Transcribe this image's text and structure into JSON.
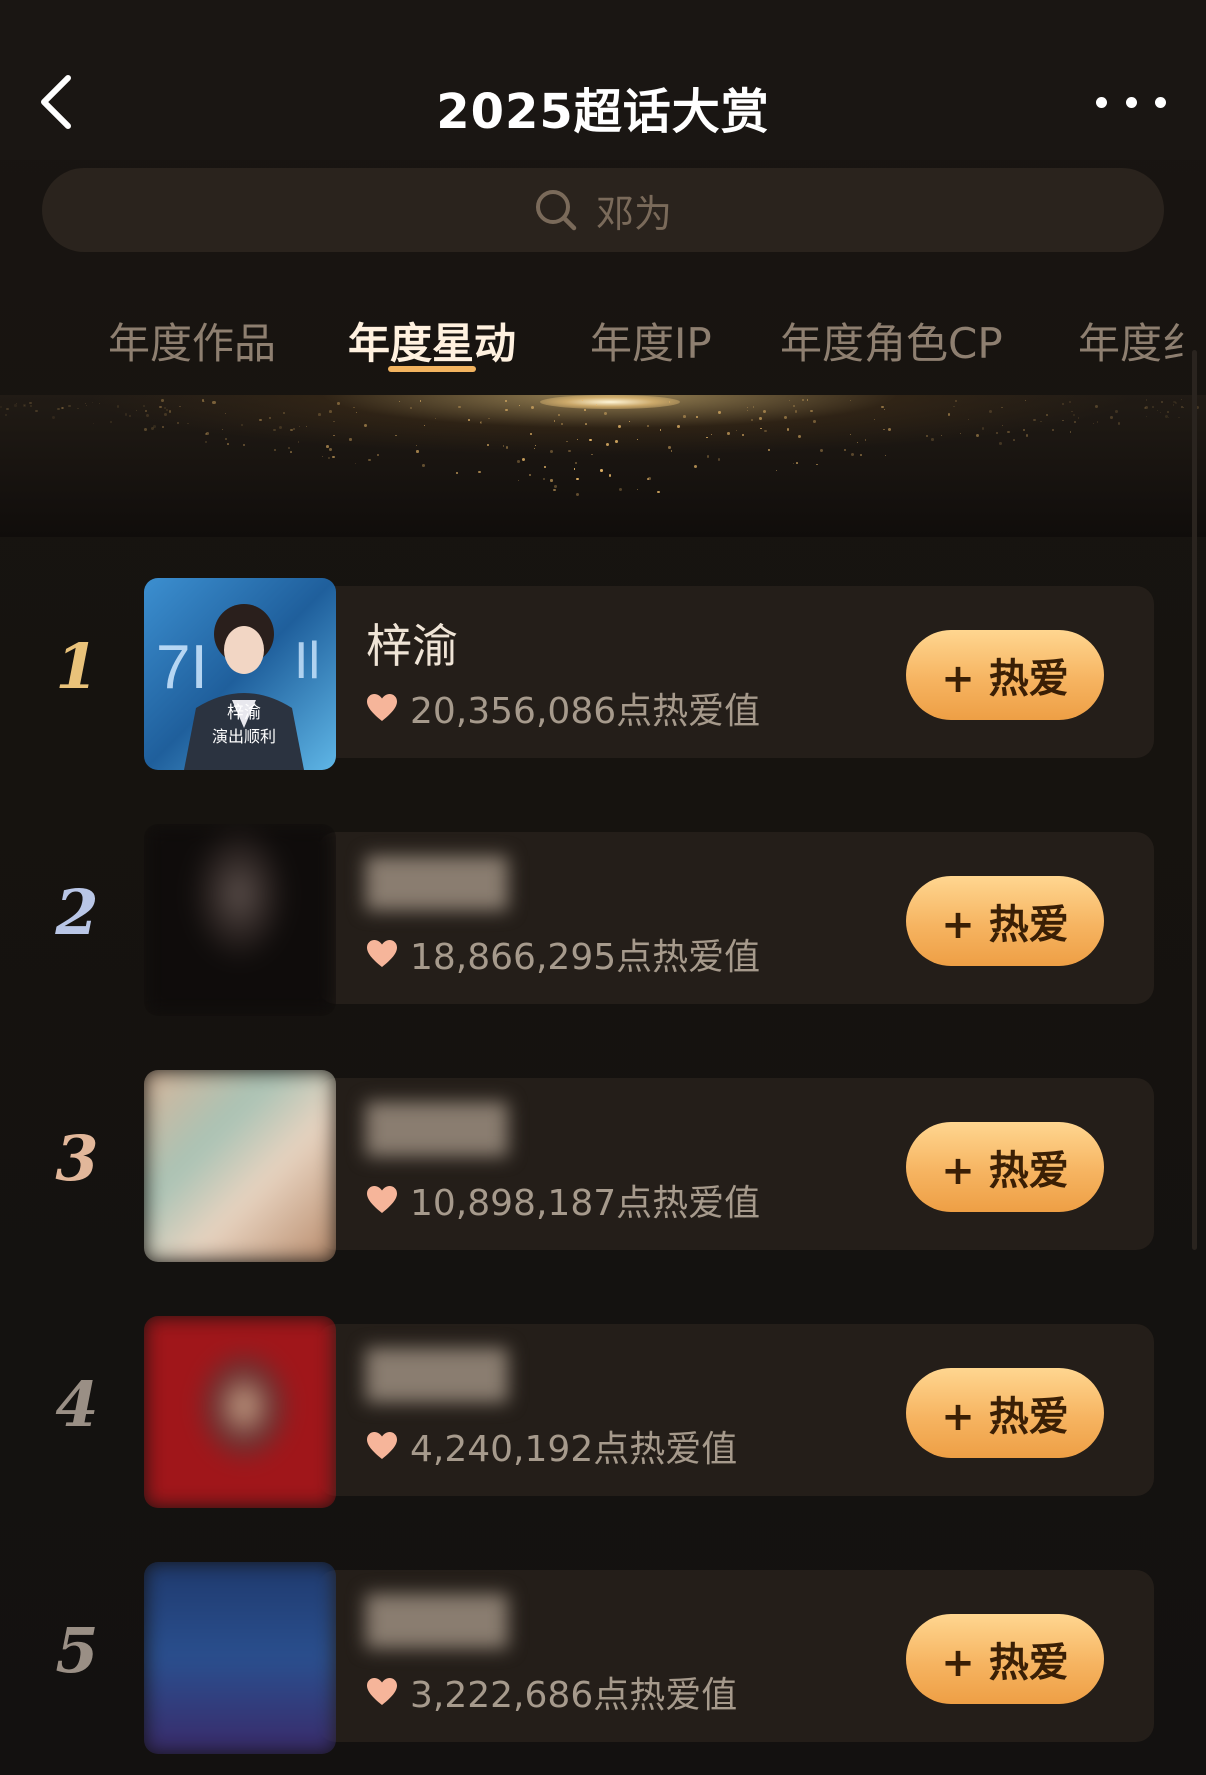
{
  "header": {
    "title": "2025超话大赏"
  },
  "search": {
    "placeholder": "邓为"
  },
  "tabs": [
    {
      "label": "年度作品",
      "active": false
    },
    {
      "label": "年度星动",
      "active": true
    },
    {
      "label": "年度IP",
      "active": false
    },
    {
      "label": "年度角色CP",
      "active": false
    },
    {
      "label": "年度纟",
      "active": false
    }
  ],
  "ranking": [
    {
      "rank": "1",
      "name": "梓渝",
      "heat": "20,356,086点热爱值",
      "button": "+ 热爱",
      "avatar_text": "梓渝",
      "avatar_subtext": "演出顺利",
      "blurred": false
    },
    {
      "rank": "2",
      "name": "",
      "heat": "18,866,295点热爱值",
      "button": "+ 热爱",
      "blurred": true
    },
    {
      "rank": "3",
      "name": "",
      "heat": "10,898,187点热爱值",
      "button": "+ 热爱",
      "blurred": true
    },
    {
      "rank": "4",
      "name": "",
      "heat": "4,240,192点热爱值",
      "button": "+ 热爱",
      "blurred": true
    },
    {
      "rank": "5",
      "name": "",
      "heat": "3,222,686点热爱值",
      "button": "+ 热爱",
      "blurred": true
    }
  ],
  "colors": {
    "accent": "#f6b461",
    "rank1": "#e9c27a",
    "rank2": "#b9c6e6",
    "rank3": "#e2b79a",
    "rank_other": "#9a8f85",
    "heart": "#f6b59a"
  }
}
